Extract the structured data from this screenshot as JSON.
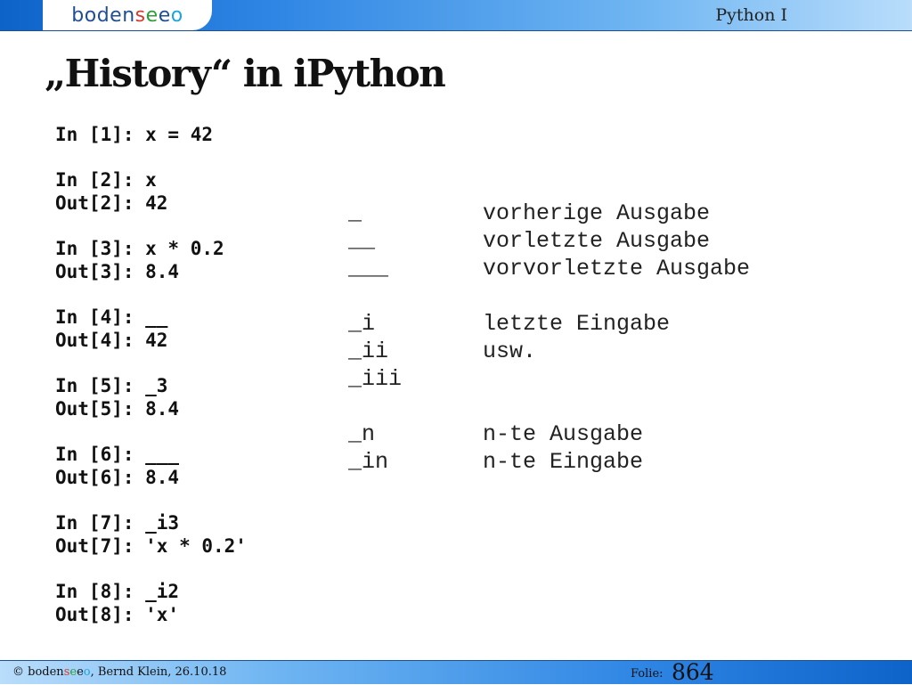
{
  "header": {
    "logo": {
      "b": "boden",
      "s": "s",
      "e": "e",
      "o": "o"
    },
    "course": "Python I"
  },
  "slide": {
    "title": "„History“ in iPython",
    "session": [
      [
        "In [1]: x = 42"
      ],
      [
        "In [2]: x",
        "Out[2]: 42"
      ],
      [
        "In [3]: x * 0.2",
        "Out[3]: 8.4"
      ],
      [
        "In [4]: __",
        "Out[4]: 42"
      ],
      [
        "In [5]: _3",
        "Out[5]: 8.4"
      ],
      [
        "In [6]: ___",
        "Out[6]: 8.4"
      ],
      [
        "In [7]: _i3",
        "Out[7]: 'x * 0.2'"
      ],
      [
        "In [8]: _i2",
        "Out[8]: 'x'"
      ]
    ],
    "legend": [
      [
        {
          "symbol": "_",
          "text": "vorherige Ausgabe"
        },
        {
          "symbol": "__",
          "text": "vorletzte Ausgabe"
        },
        {
          "symbol": "___",
          "text": "vorvorletzte Ausgabe"
        }
      ],
      [
        {
          "symbol": "_i",
          "text": "letzte Eingabe"
        },
        {
          "symbol": "_ii",
          "text": "usw."
        },
        {
          "symbol": "_iii",
          "text": ""
        }
      ],
      [
        {
          "symbol": "_n",
          "text": "n-te Ausgabe"
        },
        {
          "symbol": "_in",
          "text": "n-te Eingabe"
        }
      ]
    ]
  },
  "footer": {
    "copyright": "©",
    "author_date": ", Bernd Klein, 26.10.18",
    "folie_label": "Folie:",
    "page_number": "864"
  },
  "colors": {
    "brand_blue": "#1f4e93",
    "logo_red": "#d43b2f",
    "logo_green": "#2e9d3a",
    "logo_cyan": "#1aa7d8",
    "bar_blue": "#2f86e4"
  }
}
